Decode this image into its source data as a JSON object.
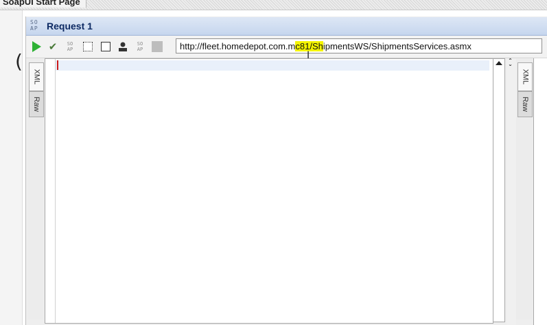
{
  "window": {
    "start_tab_label": "SoapUI Start Page"
  },
  "request": {
    "title": "Request 1",
    "soap_icon": "SO\nAP"
  },
  "toolbar": {
    "url_part1": "http://fleet.homedepot.com.m",
    "url_part2": "c81/Sh",
    "url_part3": "ipmentsWS/ShipmentsServices.asmx",
    "soap_small_1": "SO\nAP",
    "soap_small_2": "SO\nAP",
    "check_glyph": "✔"
  },
  "tabs": {
    "xml": "XML",
    "raw": "Raw"
  },
  "right_tabs": {
    "xml": "XML",
    "raw": "Raw"
  },
  "misc": {
    "paren": "(",
    "cursor_glyph": "I",
    "chev_up": "ˆ",
    "chev_down": "ˇ"
  },
  "colors": {
    "accent": "#0d2a63",
    "play": "#2eb135",
    "highlight": "#f4f400",
    "caret": "#cc1a1a"
  }
}
